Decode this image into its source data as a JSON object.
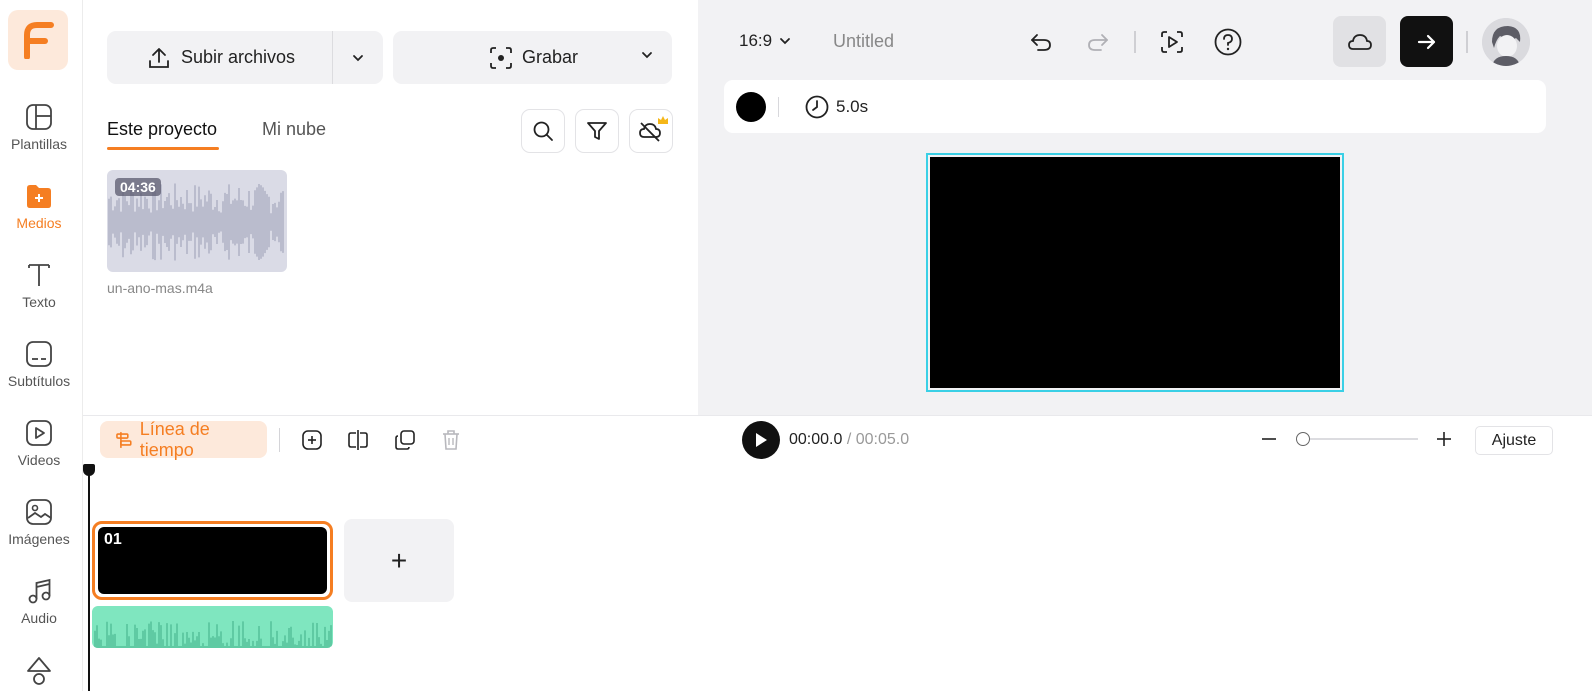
{
  "nav": {
    "logo_icon": "fliki-logo",
    "items": [
      {
        "label": "Plantillas",
        "icon": "templates-icon"
      },
      {
        "label": "Medios",
        "icon": "media-folder-icon",
        "active": true
      },
      {
        "label": "Texto",
        "icon": "text-icon"
      },
      {
        "label": "Subtítulos",
        "icon": "subtitles-icon"
      },
      {
        "label": "Videos",
        "icon": "video-icon"
      },
      {
        "label": "Imágenes",
        "icon": "image-icon"
      },
      {
        "label": "Audio",
        "icon": "music-icon"
      }
    ]
  },
  "media": {
    "upload_label": "Subir archivos",
    "record_label": "Grabar",
    "tabs": [
      {
        "label": "Este proyecto",
        "active": true
      },
      {
        "label": "Mi nube",
        "active": false
      }
    ],
    "items": [
      {
        "duration": "04:36",
        "filename": "un-ano-mas.m4a"
      }
    ]
  },
  "header": {
    "aspect_ratio": "16:9",
    "project_title": "Untitled"
  },
  "properties": {
    "background_color": "#000000",
    "duration": "5.0s"
  },
  "timeline": {
    "timeline_label": "Línea de tiempo",
    "current_time": "00:00.0",
    "total_time": "/ 00:05.0",
    "fit_label": "Ajuste",
    "scenes": [
      {
        "number": "01"
      }
    ],
    "add_scene_symbol": "+"
  },
  "colors": {
    "accent": "#f57e22",
    "accent_light": "#fde9db",
    "selection": "#3ad0e6",
    "audio_clip": "#7fe6bf"
  }
}
